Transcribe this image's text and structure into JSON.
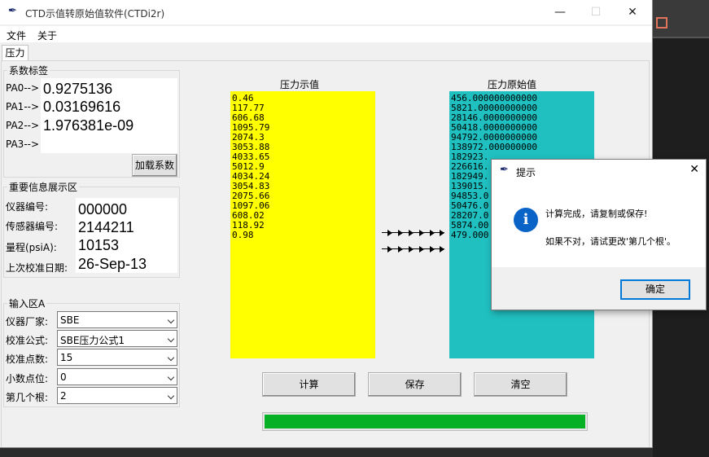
{
  "window": {
    "title": "CTD示值转原始值软件(CTDi2r)",
    "controls": {
      "minimize": "—",
      "maximize": "☐",
      "close": "✕"
    }
  },
  "menu": [
    "文件",
    "关于"
  ],
  "tab": "压力",
  "coefficients": {
    "legend": "系数标签",
    "labels": [
      "PA0-->",
      "PA1-->",
      "PA2-->",
      "PA3-->"
    ],
    "values": [
      "0.9275136",
      "0.03169616",
      "1.976381e-09",
      ""
    ],
    "load_button": "加载系数"
  },
  "info": {
    "legend": "重要信息展示区",
    "labels": [
      "仪器编号:",
      "传感器编号:",
      "量程(psiA):",
      "上次校准日期:"
    ],
    "values": [
      "000000",
      "2144211",
      "10153",
      "26-Sep-13"
    ]
  },
  "input": {
    "legend": "输入区A",
    "fields": [
      {
        "label": "仪器厂家:",
        "value": "SBE"
      },
      {
        "label": "校准公式:",
        "value": "SBE压力公式1"
      },
      {
        "label": "校准点数:",
        "value": "15"
      },
      {
        "label": "小数点位:",
        "value": "0"
      },
      {
        "label": "第几个根:",
        "value": "2"
      }
    ]
  },
  "pressure_display": {
    "header": "压力示值",
    "values": [
      "0.46",
      "117.77",
      "606.68",
      "1095.79",
      "2074.3",
      "3053.88",
      "4033.65",
      "5012.9",
      "4034.24",
      "3054.83",
      "2075.66",
      "1097.06",
      "608.02",
      "118.92",
      "0.98"
    ],
    "background": "#ffff00"
  },
  "pressure_raw": {
    "header": "压力原始值",
    "values": [
      "456.000000000000",
      "5821.00000000000",
      "28146.0000000000",
      "50418.0000000000",
      "94792.0000000000",
      "138972.000000000",
      "182923.",
      "226616.",
      "182949.",
      "139015.",
      "94853.0",
      "50476.0",
      "28207.0",
      "5874.00",
      "479.000"
    ],
    "background": "#20c0c0"
  },
  "buttons": {
    "calculate": "计算",
    "save": "保存",
    "clear": "清空"
  },
  "progress": {
    "percent": 100,
    "color": "#06b025"
  },
  "dialog": {
    "title": "提示",
    "icon": "info-icon",
    "message1": "计算完成，请复制或保存!",
    "message2": "如果不对，请试更改'第几个根'。",
    "ok": "确定"
  }
}
